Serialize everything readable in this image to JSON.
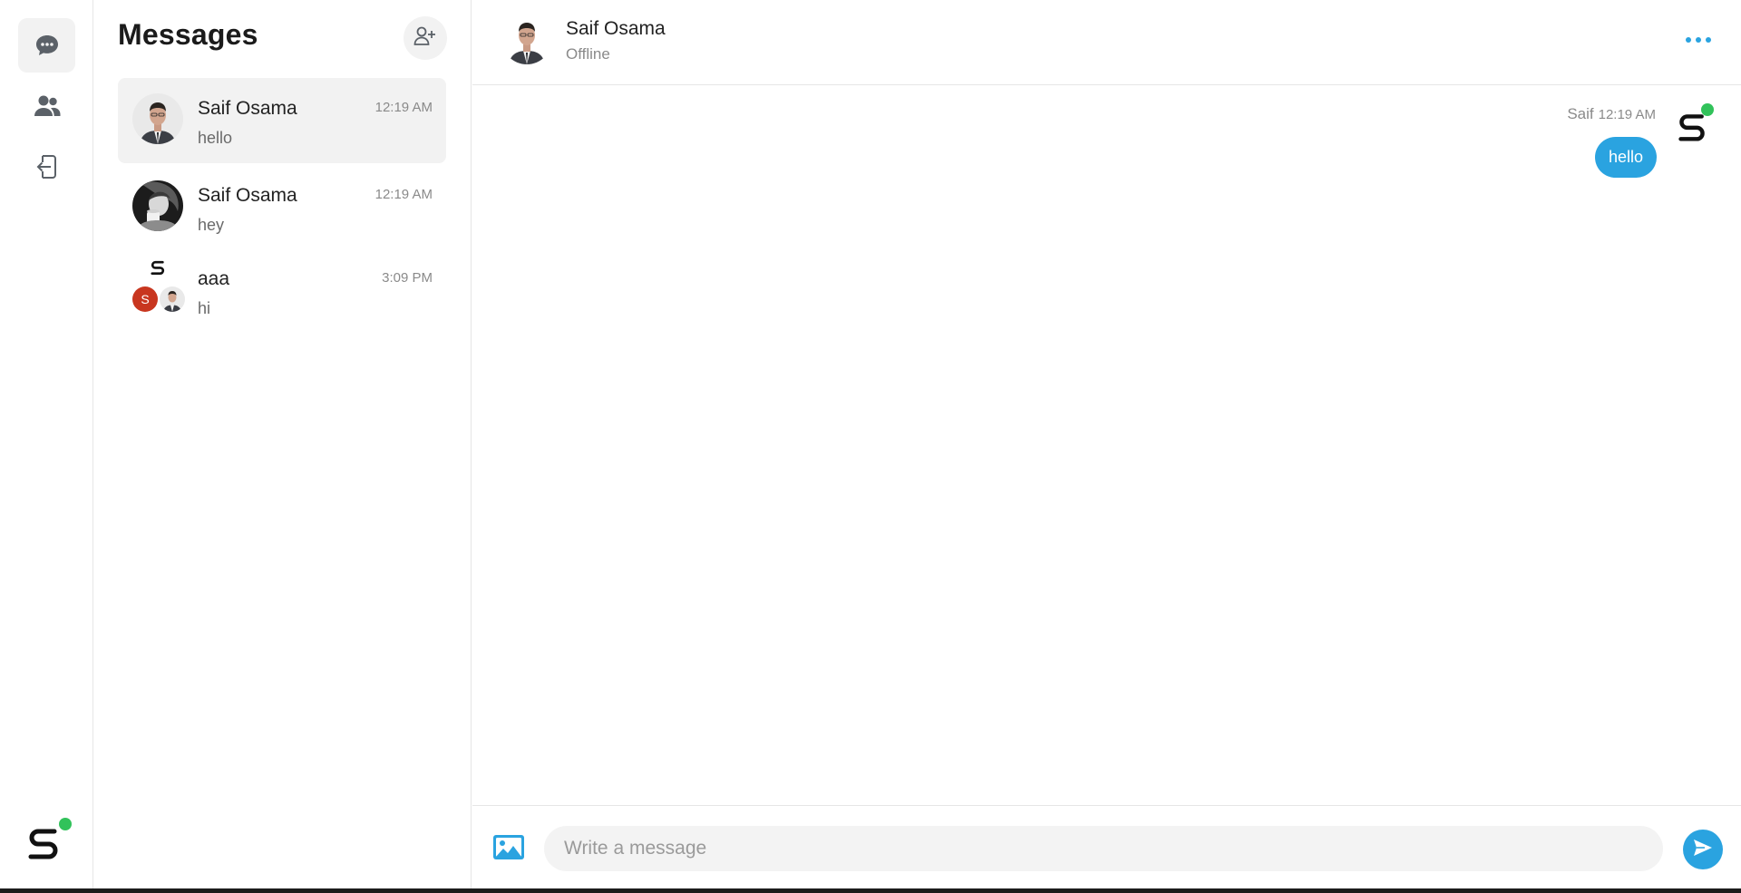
{
  "brand": {
    "accent": "#2aa3e0",
    "online": "#31c25a",
    "logo_icon": "s-logo-icon"
  },
  "rail": {
    "items": [
      {
        "name": "chats",
        "icon": "chat-bubble-icon",
        "active": true
      },
      {
        "name": "contacts",
        "icon": "users-icon",
        "active": false
      },
      {
        "name": "logout",
        "icon": "logout-icon",
        "active": false
      }
    ]
  },
  "list": {
    "title": "Messages",
    "add_icon": "add-user-icon",
    "conversations": [
      {
        "name": "Saif Osama",
        "time": "12:19 AM",
        "last_message": "hello",
        "avatar": "man-in-suit-photo"
      },
      {
        "name": "Saif Osama",
        "time": "12:19 AM",
        "last_message": "hey",
        "avatar": "woman-bw-photo"
      },
      {
        "name": "aaa",
        "time": "3:09 PM",
        "last_message": "hi",
        "avatar": "group-avatar",
        "group_initial": "S",
        "group_initial_color": "#c8361f"
      }
    ]
  },
  "chat": {
    "header": {
      "name": "Saif Osama",
      "status": "Offline",
      "more_icon": "more-dots-icon"
    },
    "messages": [
      {
        "sender": "Saif",
        "time": "12:19 AM",
        "text": "hello",
        "own": true
      }
    ],
    "composer": {
      "placeholder": "Write a message",
      "value": "",
      "image_icon": "image-icon",
      "send_icon": "send-icon"
    }
  }
}
